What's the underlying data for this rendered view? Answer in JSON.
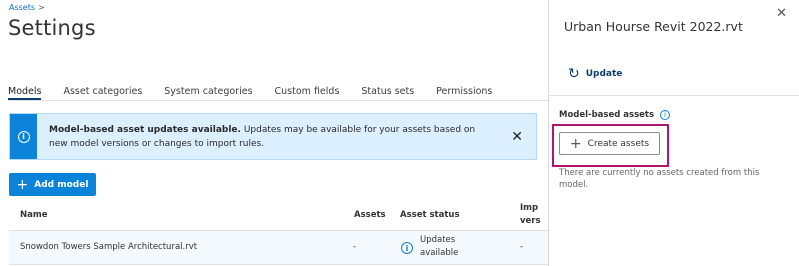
{
  "breadcrumb": {
    "parent": "Assets",
    "chevron": ">"
  },
  "page_title": "Settings",
  "tabs": [
    {
      "label": "Models",
      "active": true
    },
    {
      "label": "Asset categories",
      "active": false
    },
    {
      "label": "System categories",
      "active": false
    },
    {
      "label": "Custom fields",
      "active": false
    },
    {
      "label": "Status sets",
      "active": false
    },
    {
      "label": "Permissions",
      "active": false
    }
  ],
  "banner": {
    "icon": "i",
    "title": "Model-based asset updates available.",
    "message": "Updates may be available for your assets based on new model versions or changes to import rules.",
    "close": "✕"
  },
  "add_model": {
    "icon": "+",
    "label": "Add model"
  },
  "table": {
    "headers": {
      "name": "Name",
      "assets": "Assets",
      "status": "Asset status",
      "imported_1": "Imp",
      "imported_2": "vers"
    },
    "rows": [
      {
        "name": "Snowdon Towers Sample Architectural.rvt",
        "assets": "-",
        "status_icon": "i",
        "status_line1": "Updates",
        "status_line2": "available",
        "imported": "-"
      }
    ]
  },
  "panel": {
    "title": "Urban Hourse Revit 2022.rvt",
    "close": "✕",
    "update_icon": "↻",
    "update_label": "Update",
    "section_label": "Model-based assets",
    "section_info": "i",
    "create_icon": "+",
    "create_label": "Create assets",
    "empty_text": "There are currently no assets created from this model."
  },
  "colors": {
    "accent": "#0b83d9",
    "banner_bg": "#dcefff",
    "highlight": "#b0166e",
    "nav_dark": "#0b3d73"
  }
}
